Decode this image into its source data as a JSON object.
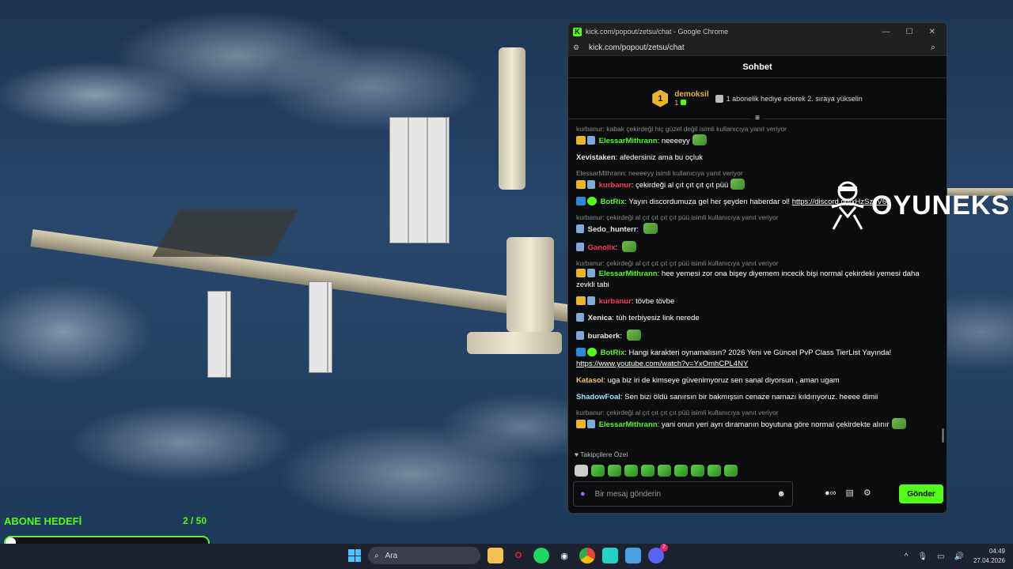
{
  "browser": {
    "window_title": "kick.com/popout/zetsu/chat - Google Chrome",
    "url": "kick.com/popout/zetsu/chat",
    "logo_letter": "K"
  },
  "chat": {
    "header_title": "Sohbet",
    "leaderboard": {
      "rank": "1",
      "name": "demoksil",
      "count": "1",
      "message": "1 abonelik hediye ederek 2. sıraya yükselin"
    },
    "messages": [
      {
        "reply": "kurbanur: kabak çekirdeği hiç güzel değil isimli kullanıcıya yanıt veriyor",
        "user": "ElessarMithrann",
        "text": "neeeeyy"
      },
      {
        "user": "Xevistaken",
        "text": "afedersiniz ama bu oçluk"
      },
      {
        "reply": "ElessarMithrann: neeeeyy  isimli kullanıcıya yanıt veriyor",
        "user": "kurbanur",
        "text": "çekirdeği al çıt çıt çıt çıt püü"
      },
      {
        "user": "BotRix",
        "text": "Yayın discordumuza gel her şeyden haberdar ol! ",
        "link": "https://discord.gg/xHzSzuV6d"
      },
      {
        "reply": "kurbanur: çekirdeği al çıt çıt çıt çıt püü  isimli kullanıcıya yanıt veriyor",
        "user": "Sedo_hunterr",
        "text": ""
      },
      {
        "user": "Ganolix",
        "text": ""
      },
      {
        "reply": "kurbanur: çekirdeği al çıt çıt çıt çıt püü  isimli kullanıcıya yanıt veriyor",
        "user": "ElessarMithrann",
        "text": "hee yemesi zor ona bişey diyemem incecik bişi normal çekirdeki yemesi daha zevkli tabi"
      },
      {
        "user": "kurbanur",
        "text": "tövbe tövbe"
      },
      {
        "user": "Xenica",
        "text": "tüh terbiyesiz link nerede"
      },
      {
        "user": "buraberk",
        "text": ""
      },
      {
        "user": "BotRix",
        "text": "Hangi karakteri oynamalısın? 2026 Yeni ve Güncel PvP Class TierList Yayında! ",
        "link": "https://www.youtube.com/watch?v=YxOmhCPL4NY"
      },
      {
        "user": "Katasol",
        "text": "uga biz iri de kimseye güvenimyoruz sen sanal diyorsun , aman ugam"
      },
      {
        "user": "ShadowFoal",
        "text": "Sen bizi öldü sanırsın bir bakmışsın cenaze namazı kıldırıyoruz. heeee dimii"
      },
      {
        "reply": "kurbanur: çekirdeği al çıt çıt çıt çıt püü  isimli kullanıcıya yanıt veriyor",
        "user": "ElessarMithrann",
        "text": "yani onun yeri ayrı dıramanın boyutuna göre normal çekirdekte alınır"
      }
    ],
    "followers_label": "Takipçilere Özel",
    "input_placeholder": "Bir mesaj gönderin",
    "send_label": "Gönder"
  },
  "overlay": {
    "logo_text": "OYUNEKS",
    "goal_label": "ABONE HEDEFİ",
    "goal_count": "2 / 50",
    "goal_progress": 0.04
  },
  "taskbar": {
    "search_label": "Ara",
    "time": "04:49",
    "date": "27.04.2026",
    "discord_badge": "2"
  },
  "colors": {
    "kick_green": "#53fc18",
    "gold": "#e9b42b",
    "red_user": "#ff3a5a"
  }
}
